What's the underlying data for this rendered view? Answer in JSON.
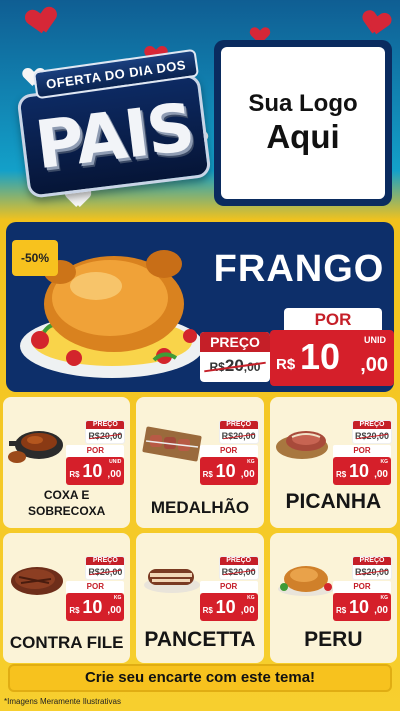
{
  "header": {
    "banner_text": "OFERTA DO DIA DOS",
    "big_word": "PAIS",
    "logo_line1": "Sua Logo",
    "logo_line2": "Aqui"
  },
  "featured": {
    "discount": "-50%",
    "name": "FRANGO",
    "old_label": "PREÇO",
    "old_currency": "R$",
    "old_amount": "20",
    "old_cents": ",00",
    "new_label": "POR",
    "unit": "UNID",
    "new_currency": "R$",
    "new_amount": "10",
    "new_cents": ",00"
  },
  "products": [
    {
      "name": "COXA E SOBRECOXA",
      "old_label": "PREÇO",
      "old_price": "R$20,00",
      "new_label": "POR",
      "currency": "R$",
      "amount": "10",
      "cents": ",00",
      "unit": "UNID",
      "icon": "chicken-pan-icon"
    },
    {
      "name": "MEDALHÃO",
      "old_label": "PREÇO",
      "old_price": "R$20,00",
      "new_label": "POR",
      "currency": "R$",
      "amount": "10",
      "cents": ",00",
      "unit": "KG",
      "icon": "skewers-icon"
    },
    {
      "name": "PICANHA",
      "old_label": "PREÇO",
      "old_price": "R$20,00",
      "new_label": "POR",
      "currency": "R$",
      "amount": "10",
      "cents": ",00",
      "unit": "KG",
      "icon": "steak-board-icon"
    },
    {
      "name": "CONTRA FILE",
      "old_label": "PREÇO",
      "old_price": "R$20,00",
      "new_label": "POR",
      "currency": "R$",
      "amount": "10",
      "cents": ",00",
      "unit": "KG",
      "icon": "steak-icon"
    },
    {
      "name": "PANCETTA",
      "old_label": "PREÇO",
      "old_price": "R$20,00",
      "new_label": "POR",
      "currency": "R$",
      "amount": "10",
      "cents": ",00",
      "unit": "KG",
      "icon": "pork-belly-icon"
    },
    {
      "name": "PERU",
      "old_label": "PREÇO",
      "old_price": "R$20,00",
      "new_label": "POR",
      "currency": "R$",
      "amount": "10",
      "cents": ",00",
      "unit": "KG",
      "icon": "turkey-icon"
    }
  ],
  "footer": {
    "cta": "Crie seu encarte com este tema!",
    "disclaimer": "*Imagens Meramente Ilustrativas"
  },
  "colors": {
    "navy": "#0d2f6a",
    "red": "#d51f2a",
    "yellow": "#f7c21e",
    "card": "#fbf3d7"
  }
}
